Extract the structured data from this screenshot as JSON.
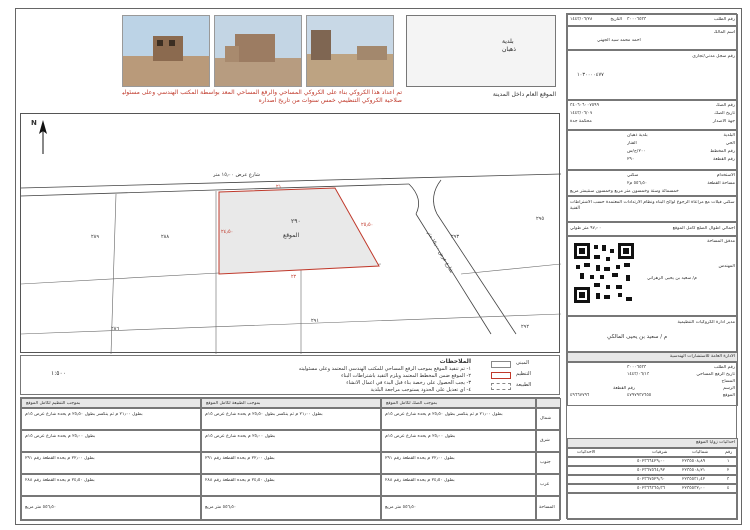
{
  "header_photos": [
    {
      "alt": "site-photo-1"
    },
    {
      "alt": "site-photo-2"
    },
    {
      "alt": "site-photo-3"
    }
  ],
  "municipality_box": {
    "line1": "بلدية",
    "line2": "ذهبان"
  },
  "general_location_title": "الموقع العام داخل المدينة",
  "warning_text": {
    "line1": "تم اعداد هذا الكروكي بناء على الكروكي المساحي والرفع المساحي المعد بواسطة المكتب الهندسي وعلى مسئولية",
    "line2": "صلاحية الكروكي التنظيمي خمس سنوات من تاريخ اصداره"
  },
  "right_panel": {
    "number_label": "رقم الطلب",
    "number_value": "٣٠٠٠٦٥٣٣",
    "date_label": "التاريخ",
    "date_value": "١٤٤٣/٠٦/٢٨",
    "owner_label": "اسم المالك",
    "owner_value": "احمد محمد سيد الجهني",
    "id_label": "رقم سجل مدني/تجاري",
    "id_value": "١٠٣٠٠٠٠٤٧٧",
    "deed_label": "رقم الصك",
    "deed_value": "٣٤٠٦٠٦٠٠٧٥٩٩",
    "deed_date_label": "تاريخ الصك",
    "deed_date_value": "١٤٤٣/٠٦/٠٧",
    "issuer_label": "جهة الاصدار",
    "issuer_value": "محكمة جدة",
    "municipality_label": "البلدية",
    "municipality_value": "بلدية ذهبان",
    "district_label": "الحي",
    "district_value": "الفنار",
    "plan_label": "رقم المخطط",
    "plan_value": "٢٠٠/ج/س",
    "parcel_label": "رقم القطعة",
    "parcel_value": "٢٩٠",
    "usage_label": "الاستخدام",
    "usage_value": "سكني",
    "area_label": "مساحة القطعة",
    "area_value": "٥٥٦٫٥٠ م٢",
    "area_words": "خمسمائة وستة وخمسون متر مربع وخمسون سنتيمتر مربع",
    "notes_block": "سكني فيلات مع مراعاة الرجوع لوائح البناء ونظام الارتدادات المعتمدة حسب الاشتراطات الفنية",
    "coords_label": "احداثيات الموقع",
    "coords_value": "٢١٫٨٢٩٣ , ٣٩٫١٥٦٢",
    "total_area_label": "اجمالي اطوال الضلع كامل الموقع",
    "total_area_value": "٩٧٫٠٠ متر طولي",
    "checker_label": "مدقق المساحة",
    "checker_value": "",
    "engineer_label": "المهندس",
    "engineer_value": "م/ سعيد بن يحيى الزهراني",
    "manager_title": "مدير ادارة الكروكيات التنظيمية",
    "manager_name": "م / سعيد بن يحيى المالكي",
    "sections_title": "الادارة العامة للاستشارات الهندسية",
    "field1_label": "رقم الطلب",
    "field1_value": "٣٠٠٠٦٥٣٣",
    "field2_label": "تاريخ الرفع المساحي",
    "field2_value": "١٤٤٣/٠٦/١٣",
    "field3_label": "المساح",
    "field3_value": "",
    "field4_label": "الرسم",
    "field4_value": "",
    "field5_label": "رقم القطعة",
    "field5_value": "٤٩٦٦٧٧٩٦",
    "field6_label": "الموقع",
    "field6_value": "٤٧٩٧٩٣٧٦٥٥",
    "coords_table_title": "احداثيات زوايا الموقع",
    "coords_headers": [
      "الاحداثيات",
      "شرقيات",
      "شماليات",
      "رقم"
    ],
    "coords_rows": [
      [
        "٥٠٢٣٦٦٤٢٩٫٠٠",
        "٢٢٣٥٥٠٨٫٨٩",
        "١"
      ],
      [
        "٥٠٢٣٦٧٥٦٤٫٩٢",
        "٢٢٣٥٥٠٨٫٢١",
        "٢"
      ],
      [
        "٥٠٢٣٦٧٥٢٩٫٦٠",
        "٢٢٣٥٥٣١٫٤٢",
        "٣"
      ],
      [
        "٥٠٢٣٦٦٣٦٥٫٣٦",
        "٢٢٣٥٥٣٢٫٠٠",
        "٤"
      ]
    ]
  },
  "map": {
    "north_label": "N",
    "street_top": "شارع عرض ١٥٫٠٠ متر",
    "street_diag": "شارع عرض ١٥٫٠٠ متر",
    "parcel_main": "٢٩٠",
    "parcel_site": "الموقع",
    "parcel_289": "٢٨٩",
    "parcel_288": "٢٨٨",
    "parcel_291": "٢٩١",
    "parcel_293": "٢٩٣",
    "parcel_292": "٢٩٢",
    "parcel_295": "٢٩٥",
    "parcel_286": "٢٨٦",
    "dim_top": "٢١",
    "dim_right": "٢٥٫٥٠",
    "dim_bottom": "٢٢",
    "dim_left": "٢٤٫٥٠",
    "scale_value": "١:٥٠٠"
  },
  "legend": {
    "title": "الملاحظات",
    "notes": [
      "١- تم تنفيذ الموقع بموجب الرفع المساحي للمكتب الهندسي المعتمد وعلى مسئوليته",
      "٢- الموقع ضمن المخطط المعتمد ويلزم التقيد باشتراطات البناء",
      "٣- يجب الحصول على رخصة بناء قبل البدء في اعمال الانشاء",
      "٤- اي تعديل على الحدود يستوجب مراجعة البلدية"
    ],
    "key_built": "المبنى",
    "key_planning": "التنظيم",
    "key_nature": "الطبيعة"
  },
  "bottom_table": {
    "headers": [
      "بموجب الصك لكامل الموقع",
      "بموجب الطبيعة لكامل الموقع",
      "بموجب التنظيم لكامل الموقع"
    ],
    "rows": [
      {
        "dir": "شمال",
        "deed": "بطول ٢١٫٠٠ م ثم ينكسر بطول ٢٥٫٥٠ م يحده شارع عرض ١٥م",
        "nature": "بطول ٢١٫٠٠ م ثم ينكسر بطول ٢٥٫٥٠ م يحده شارع عرض ١٥م",
        "plan": "بطول ٢١٫٠٠ م ثم ينكسر بطول ٢٥٫٥٠ م يحده شارع عرض ١٥م"
      },
      {
        "dir": "شرق",
        "deed": "بطول ٢٥٫٠٠ م يحده شارع عرض ١٥م",
        "nature": "بطول ٢٥٫٠٠ م يحده شارع عرض ١٥م",
        "plan": "بطول ٢٥٫٠٠ م يحده شارع عرض ١٥م"
      },
      {
        "dir": "جنوب",
        "deed": "بطول ٢٢٫٠٠ م يحده القطعة رقم ٢٩١",
        "nature": "بطول ٢٢٫٠٠ م يحده القطعة رقم ٢٩١",
        "plan": "بطول ٢٢٫٠٠ م يحده القطعة رقم ٢٩١"
      },
      {
        "dir": "غرب",
        "deed": "بطول ٢٤٫٥٠ م يحده القطعة رقم ٢٨٨",
        "nature": "بطول ٢٤٫٥٠ م يحده القطعة رقم ٢٨٨",
        "plan": "بطول ٢٤٫٥٠ م يحده القطعة رقم ٢٨٨"
      },
      {
        "dir": "المساحة",
        "deed": "٥٥٦٫٥٠ متر مربع",
        "nature": "٥٥٦٫٥٠ متر مربع",
        "plan": "٥٥٦٫٥٠ متر مربع"
      }
    ]
  },
  "colors": {
    "parcel_fill": "#e9e9e9",
    "parcel_border": "#c0392b",
    "accent_red": "#c0392b"
  }
}
